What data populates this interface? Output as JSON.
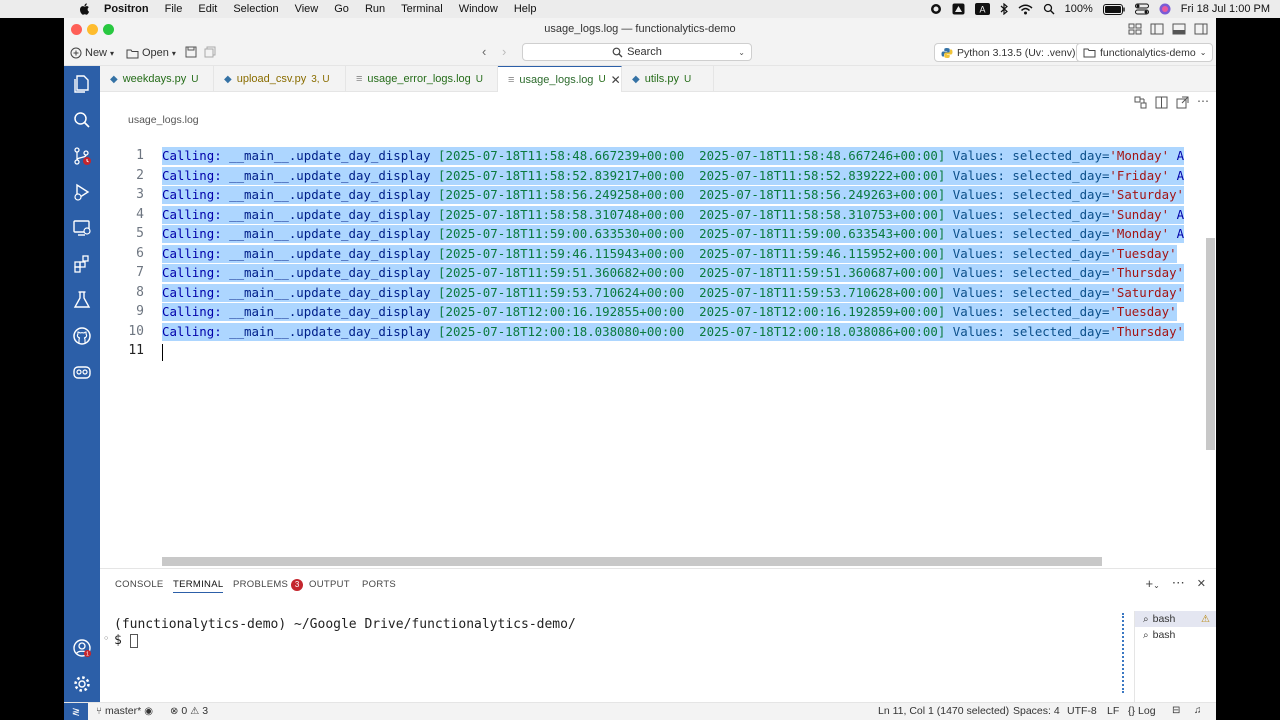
{
  "menubar": {
    "items": [
      "Positron",
      "File",
      "Edit",
      "Selection",
      "View",
      "Go",
      "Run",
      "Terminal",
      "Window",
      "Help"
    ],
    "battery": "100%",
    "datetime": "Fri 18 Jul  1:00 PM"
  },
  "window": {
    "title": "usage_logs.log — functionalytics-demo"
  },
  "toolbar": {
    "new_label": "New",
    "open_label": "Open",
    "search_label": "Search",
    "interpreter_label": "Python 3.13.5 (Uv: .venv)",
    "workspace_label": "functionalytics-demo"
  },
  "tabs": [
    {
      "name": "weekdays.py",
      "status": "U"
    },
    {
      "name": "upload_csv.py",
      "status": "3, U"
    },
    {
      "name": "usage_error_logs.log",
      "status": "U"
    },
    {
      "name": "usage_logs.log",
      "status": "U"
    },
    {
      "name": "utils.py",
      "status": "U"
    }
  ],
  "breadcrumb": "usage_logs.log",
  "editor": {
    "lines": [
      {
        "n": "1",
        "call": "Calling: ",
        "fn": "__main__.update_day_display",
        "ts": " [2025-07-18T11:58:48.667239+00:00  2025-07-18T11:58:48.667246+00:00]",
        "vals": " Values: selected_day=",
        "day": "'Monday'",
        "tail": " A"
      },
      {
        "n": "2",
        "call": "Calling: ",
        "fn": "__main__.update_day_display",
        "ts": " [2025-07-18T11:58:52.839217+00:00  2025-07-18T11:58:52.839222+00:00]",
        "vals": " Values: selected_day=",
        "day": "'Friday'",
        "tail": " A"
      },
      {
        "n": "3",
        "call": "Calling: ",
        "fn": "__main__.update_day_display",
        "ts": " [2025-07-18T11:58:56.249258+00:00  2025-07-18T11:58:56.249263+00:00]",
        "vals": " Values: selected_day=",
        "day": "'Saturday'",
        "tail": ""
      },
      {
        "n": "4",
        "call": "Calling: ",
        "fn": "__main__.update_day_display",
        "ts": " [2025-07-18T11:58:58.310748+00:00  2025-07-18T11:58:58.310753+00:00]",
        "vals": " Values: selected_day=",
        "day": "'Sunday'",
        "tail": " A"
      },
      {
        "n": "5",
        "call": "Calling: ",
        "fn": "__main__.update_day_display",
        "ts": " [2025-07-18T11:59:00.633530+00:00  2025-07-18T11:59:00.633543+00:00]",
        "vals": " Values: selected_day=",
        "day": "'Monday'",
        "tail": " A"
      },
      {
        "n": "6",
        "call": "Calling: ",
        "fn": "__main__.update_day_display",
        "ts": " [2025-07-18T11:59:46.115943+00:00  2025-07-18T11:59:46.115952+00:00]",
        "vals": " Values: selected_day=",
        "day": "'Tuesday'",
        "tail": ""
      },
      {
        "n": "7",
        "call": "Calling: ",
        "fn": "__main__.update_day_display",
        "ts": " [2025-07-18T11:59:51.360682+00:00  2025-07-18T11:59:51.360687+00:00]",
        "vals": " Values: selected_day=",
        "day": "'Thursday'",
        "tail": ""
      },
      {
        "n": "8",
        "call": "Calling: ",
        "fn": "__main__.update_day_display",
        "ts": " [2025-07-18T11:59:53.710624+00:00  2025-07-18T11:59:53.710628+00:00]",
        "vals": " Values: selected_day=",
        "day": "'Saturday'",
        "tail": ""
      },
      {
        "n": "9",
        "call": "Calling: ",
        "fn": "__main__.update_day_display",
        "ts": " [2025-07-18T12:00:16.192855+00:00  2025-07-18T12:00:16.192859+00:00]",
        "vals": " Values: selected_day=",
        "day": "'Tuesday'",
        "tail": ""
      },
      {
        "n": "10",
        "call": "Calling: ",
        "fn": "__main__.update_day_display",
        "ts": " [2025-07-18T12:00:18.038080+00:00  2025-07-18T12:00:18.038086+00:00]",
        "vals": " Values: selected_day=",
        "day": "'Thursday'",
        "tail": ""
      }
    ],
    "last_line_number": "11"
  },
  "panel": {
    "tabs": [
      "CONSOLE",
      "TERMINAL",
      "PROBLEMS",
      "OUTPUT",
      "PORTS"
    ],
    "problems_count": "3",
    "terminal_line1": "(functionalytics-demo) ~/Google Drive/functionalytics-demo/",
    "terminal_prompt": "$ ",
    "terminals": [
      "bash",
      "bash"
    ]
  },
  "statusbar": {
    "branch": "master*",
    "errors": "0",
    "warnings": "3",
    "position": "Ln 11, Col 1 (1470 selected)",
    "spaces": "Spaces: 4",
    "encoding": "UTF-8",
    "eol": "LF",
    "language": "Log"
  },
  "colors": {
    "accent": "#2c5fa8",
    "selection": "#add6ff",
    "badge": "#c4262e"
  }
}
